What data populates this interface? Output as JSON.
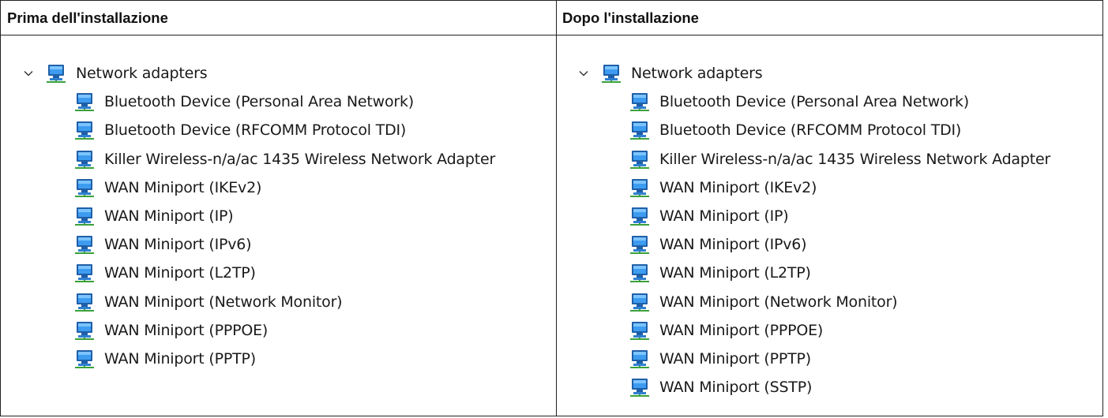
{
  "columns": [
    {
      "header": "Prima dell'installazione",
      "root": "Network adapters",
      "items": [
        "Bluetooth Device (Personal Area Network)",
        "Bluetooth Device (RFCOMM Protocol TDI)",
        "Killer Wireless-n/a/ac 1435 Wireless Network Adapter",
        "WAN Miniport (IKEv2)",
        "WAN Miniport (IP)",
        "WAN Miniport (IPv6)",
        "WAN Miniport (L2TP)",
        "WAN Miniport (Network Monitor)",
        "WAN Miniport (PPPOE)",
        "WAN Miniport (PPTP)"
      ]
    },
    {
      "header": "Dopo l'installazione",
      "root": "Network adapters",
      "items": [
        "Bluetooth Device (Personal Area Network)",
        "Bluetooth Device (RFCOMM Protocol TDI)",
        "Killer Wireless-n/a/ac 1435 Wireless Network Adapter",
        "WAN Miniport (IKEv2)",
        "WAN Miniport (IP)",
        "WAN Miniport (IPv6)",
        "WAN Miniport (L2TP)",
        "WAN Miniport (Network Monitor)",
        "WAN Miniport (PPPOE)",
        "WAN Miniport (PPTP)",
        "WAN Miniport (SSTP)"
      ]
    }
  ],
  "icons": {
    "expand": "chevron-down-icon",
    "device": "network-adapter-icon"
  },
  "colors": {
    "icon_screen": "#2f8fe0",
    "icon_screen_light": "#7cc4ff",
    "icon_base": "#1f5fa8",
    "icon_cable": "#3aa13a"
  }
}
